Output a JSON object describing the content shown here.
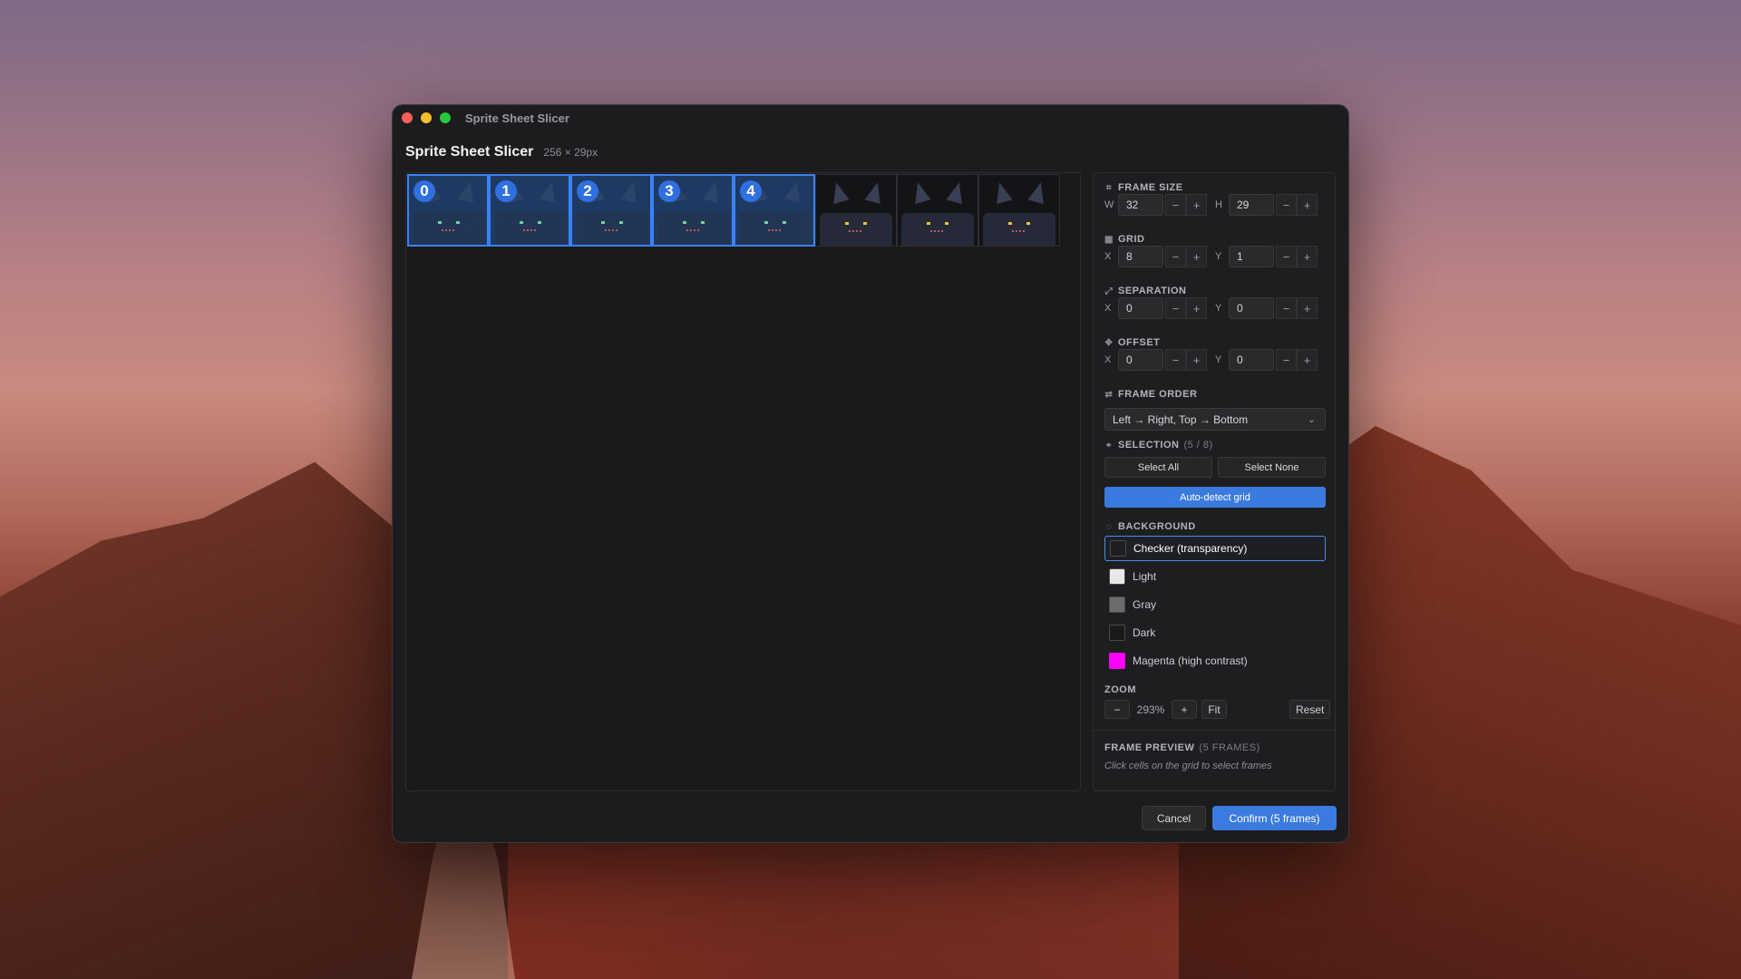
{
  "window": {
    "title": "Sprite Sheet Slicer"
  },
  "dialog": {
    "title": "Sprite Sheet Slicer",
    "dimensions": "256 × 29px"
  },
  "sprite_cells": [
    {
      "index": "0",
      "selected": true
    },
    {
      "index": "1",
      "selected": true
    },
    {
      "index": "2",
      "selected": true
    },
    {
      "index": "3",
      "selected": true
    },
    {
      "index": "4",
      "selected": true
    },
    {
      "index": "",
      "selected": false
    },
    {
      "index": "",
      "selected": false
    },
    {
      "index": "",
      "selected": false
    }
  ],
  "frame_size": {
    "label": "FRAME SIZE",
    "w_axis": "W",
    "w_value": "32",
    "h_axis": "H",
    "h_value": "29"
  },
  "grid": {
    "label": "GRID",
    "x_axis": "X",
    "x_value": "8",
    "y_axis": "Y",
    "y_value": "1"
  },
  "separation": {
    "label": "SEPARATION",
    "x_axis": "X",
    "x_value": "0",
    "y_axis": "Y",
    "y_value": "0"
  },
  "offset": {
    "label": "OFFSET",
    "x_axis": "X",
    "x_value": "0",
    "y_axis": "Y",
    "y_value": "0"
  },
  "stepper": {
    "minus": "−",
    "plus": "+"
  },
  "frame_order": {
    "label": "FRAME ORDER",
    "value": "Left → Right, Top → Bottom"
  },
  "selection": {
    "label": "SELECTION",
    "count": "(5 / 8)",
    "select_all": "Select All",
    "select_none": "Select None"
  },
  "auto_detect": "Auto-detect grid",
  "background": {
    "label": "BACKGROUND",
    "options": [
      {
        "label": "Checker (transparency)",
        "swatch": "#1e1e20"
      },
      {
        "label": "Light",
        "swatch": "#e8e8e8"
      },
      {
        "label": "Gray",
        "swatch": "#6b6b6b"
      },
      {
        "label": "Dark",
        "swatch": "#1a1a1a"
      },
      {
        "label": "Magenta (high contrast)",
        "swatch": "#ff00ff"
      }
    ],
    "selected": "Checker (transparency)"
  },
  "zoom": {
    "label": "ZOOM",
    "minus": "−",
    "value": "293%",
    "plus": "+",
    "fit": "Fit",
    "reset": "Reset"
  },
  "frame_preview": {
    "label": "FRAME PREVIEW",
    "count": "(5 FRAMES)",
    "hint": "Click cells on the grid to select frames"
  },
  "footer": {
    "cancel": "Cancel",
    "confirm": "Confirm (5 frames)"
  },
  "colors": {
    "accent": "#3b7be0",
    "selection": "#3b82f6",
    "window_bg": "#1c1c1e"
  }
}
